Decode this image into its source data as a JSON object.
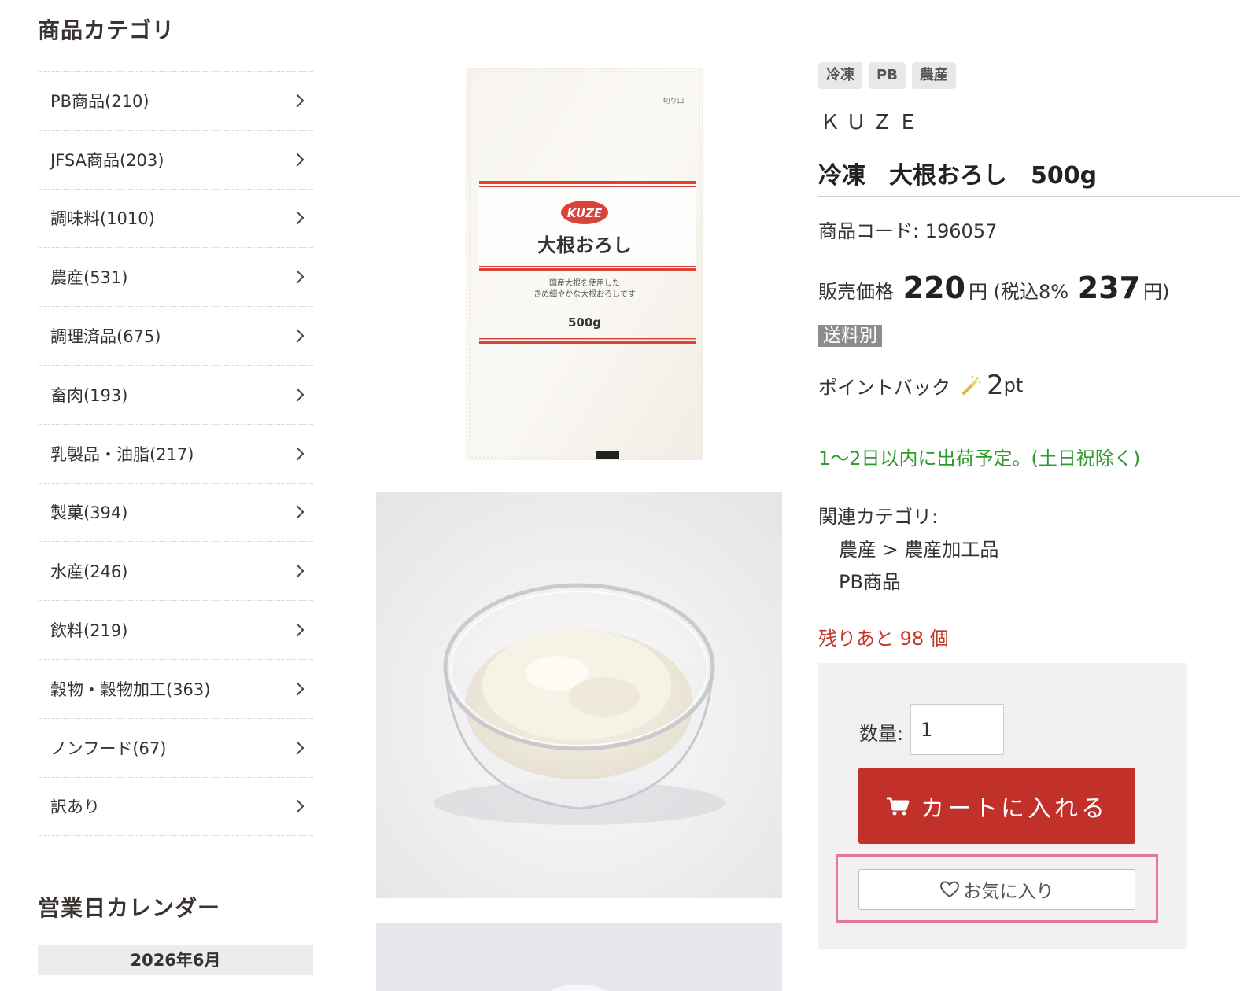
{
  "sidebar": {
    "title": "商品カテゴリ",
    "categories": [
      {
        "label": "PB商品(210)"
      },
      {
        "label": "JFSA商品(203)"
      },
      {
        "label": "調味料(1010)"
      },
      {
        "label": "農産(531)"
      },
      {
        "label": "調理済品(675)"
      },
      {
        "label": "畜肉(193)"
      },
      {
        "label": "乳製品・油脂(217)"
      },
      {
        "label": "製菓(394)"
      },
      {
        "label": "水産(246)"
      },
      {
        "label": "飲料(219)"
      },
      {
        "label": "穀物・穀物加工(363)"
      },
      {
        "label": "ノンフード(67)"
      },
      {
        "label": "訳あり"
      }
    ],
    "calendar_title": "営業日カレンダー",
    "calendar_month": "2026年6月"
  },
  "package_image": {
    "brand_logo": "KUZE",
    "name": "大根おろし",
    "tagline_1": "国産大根を使用した",
    "tagline_2": "きめ細やかな大根おろしです",
    "weight": "500g",
    "cut_mark": "切り口"
  },
  "product": {
    "tags": [
      "冷凍",
      "PB",
      "農産"
    ],
    "brand": "ＫＵＺＥ",
    "name": "冷凍　大根おろし　500g",
    "code_label": "商品コード:",
    "code": "196057",
    "price_label": "販売価格",
    "price": "220",
    "yen": "円",
    "tax_label": "(税込8%",
    "price_tax": "237",
    "yen_close": "円)",
    "shipping": "送料別",
    "points_label": "ポイントバック",
    "points_value": "2",
    "points_unit": "pt",
    "ship_schedule": "1〜2日以内に出荷予定。(土日祝除く)",
    "related_label": "関連カテゴリ:",
    "related": [
      "農産 > 農産加工品",
      "PB商品"
    ],
    "remaining": "残りあと 98 個"
  },
  "cart": {
    "qty_label": "数量:",
    "qty_value": "1",
    "add_to_cart": "カートに入れる",
    "favorite": "お気に入り"
  },
  "colors": {
    "cart_button": "#c1312a",
    "ship_schedule": "#2e9b2e",
    "remaining": "#c0392b",
    "highlight_frame": "#e0789f"
  }
}
